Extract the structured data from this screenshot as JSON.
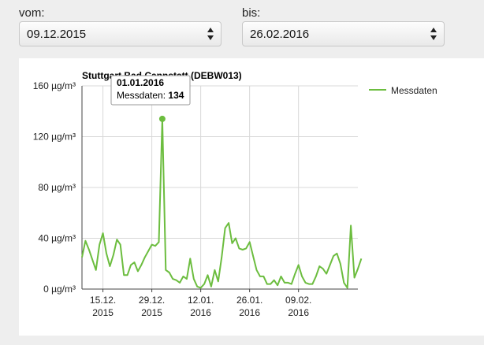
{
  "filters": {
    "from_label": "vom:",
    "from_value": "09.12.2015",
    "to_label": "bis:",
    "to_value": "26.02.2016"
  },
  "tooltip": {
    "date": "01.01.2016",
    "label": "Messdaten:",
    "value": "134"
  },
  "colors": {
    "series": "#6cbd3f"
  },
  "chart_data": {
    "type": "line",
    "title": "Stuttgart Bad Cannstatt (DEBW013)",
    "xlabel": "",
    "ylabel": "",
    "x_range": [
      "2015-12-09",
      "2016-02-26"
    ],
    "ylim": [
      0,
      160
    ],
    "y_ticks": [
      0,
      40,
      80,
      120,
      160
    ],
    "y_tick_labels": [
      "0 µg/m³",
      "40 µg/m³",
      "80 µg/m³",
      "120 µg/m³",
      "160 µg/m³"
    ],
    "x_ticks": [
      "2015-12-15",
      "2015-12-29",
      "2016-01-12",
      "2016-01-26",
      "2016-02-09"
    ],
    "x_tick_labels": [
      [
        "15.12.",
        "2015"
      ],
      [
        "29.12.",
        "2015"
      ],
      [
        "12.01.",
        "2016"
      ],
      [
        "26.01.",
        "2016"
      ],
      [
        "09.02.",
        "2016"
      ]
    ],
    "grid": true,
    "legend_position": "top-right",
    "series": [
      {
        "name": "Messdaten",
        "points": [
          [
            "2015-12-09",
            25
          ],
          [
            "2015-12-10",
            38
          ],
          [
            "2015-12-11",
            31
          ],
          [
            "2015-12-12",
            23
          ],
          [
            "2015-12-13",
            15
          ],
          [
            "2015-12-14",
            35
          ],
          [
            "2015-12-15",
            44
          ],
          [
            "2015-12-16",
            28
          ],
          [
            "2015-12-17",
            18
          ],
          [
            "2015-12-18",
            27
          ],
          [
            "2015-12-19",
            39
          ],
          [
            "2015-12-20",
            35
          ],
          [
            "2015-12-21",
            11
          ],
          [
            "2015-12-22",
            11
          ],
          [
            "2015-12-23",
            19
          ],
          [
            "2015-12-24",
            21
          ],
          [
            "2015-12-25",
            14
          ],
          [
            "2015-12-26",
            19
          ],
          [
            "2015-12-27",
            25
          ],
          [
            "2015-12-28",
            30
          ],
          [
            "2015-12-29",
            35
          ],
          [
            "2015-12-30",
            34
          ],
          [
            "2015-12-31",
            37
          ],
          [
            "2016-01-01",
            134
          ],
          [
            "2016-01-02",
            15
          ],
          [
            "2016-01-03",
            13
          ],
          [
            "2016-01-04",
            8
          ],
          [
            "2016-01-05",
            7
          ],
          [
            "2016-01-06",
            5
          ],
          [
            "2016-01-07",
            10
          ],
          [
            "2016-01-08",
            8
          ],
          [
            "2016-01-09",
            24
          ],
          [
            "2016-01-10",
            8
          ],
          [
            "2016-01-11",
            2
          ],
          [
            "2016-01-12",
            1
          ],
          [
            "2016-01-13",
            4
          ],
          [
            "2016-01-14",
            11
          ],
          [
            "2016-01-15",
            2
          ],
          [
            "2016-01-16",
            15
          ],
          [
            "2016-01-17",
            6
          ],
          [
            "2016-01-18",
            25
          ],
          [
            "2016-01-19",
            48
          ],
          [
            "2016-01-20",
            52
          ],
          [
            "2016-01-21",
            36
          ],
          [
            "2016-01-22",
            40
          ],
          [
            "2016-01-23",
            32
          ],
          [
            "2016-01-24",
            31
          ],
          [
            "2016-01-25",
            32
          ],
          [
            "2016-01-26",
            37
          ],
          [
            "2016-01-27",
            26
          ],
          [
            "2016-01-28",
            15
          ],
          [
            "2016-01-29",
            10
          ],
          [
            "2016-01-30",
            10
          ],
          [
            "2016-01-31",
            4
          ],
          [
            "2016-02-01",
            4
          ],
          [
            "2016-02-02",
            7
          ],
          [
            "2016-02-03",
            3
          ],
          [
            "2016-02-04",
            10
          ],
          [
            "2016-02-05",
            5
          ],
          [
            "2016-02-06",
            5
          ],
          [
            "2016-02-07",
            4
          ],
          [
            "2016-02-08",
            12
          ],
          [
            "2016-02-09",
            19
          ],
          [
            "2016-02-10",
            10
          ],
          [
            "2016-02-11",
            5
          ],
          [
            "2016-02-12",
            4
          ],
          [
            "2016-02-13",
            4
          ],
          [
            "2016-02-14",
            10
          ],
          [
            "2016-02-15",
            18
          ],
          [
            "2016-02-16",
            16
          ],
          [
            "2016-02-17",
            12
          ],
          [
            "2016-02-18",
            19
          ],
          [
            "2016-02-19",
            26
          ],
          [
            "2016-02-20",
            28
          ],
          [
            "2016-02-21",
            20
          ],
          [
            "2016-02-22",
            5
          ],
          [
            "2016-02-23",
            1
          ],
          [
            "2016-02-24",
            50
          ],
          [
            "2016-02-25",
            9
          ],
          [
            "2016-02-26",
            16
          ],
          [
            "2016-02-27",
            24
          ]
        ]
      }
    ]
  }
}
